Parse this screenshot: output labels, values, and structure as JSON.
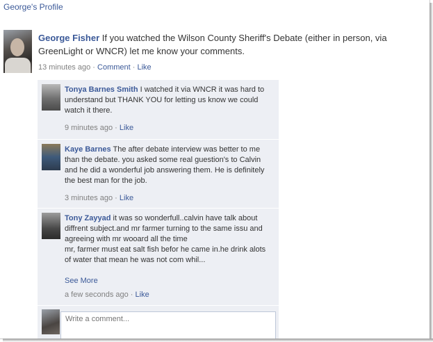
{
  "profile_link": "George's Profile",
  "post": {
    "author": "George Fisher",
    "text": "If you watched the Wilson County Sheriff's Debate (either in person, via GreenLight or WNCR) let me know your comments.",
    "time": "13 minutes ago",
    "comment_label": "Comment",
    "like_label": "Like",
    "separator": "·"
  },
  "comments": [
    {
      "author": "Tonya Barnes Smith",
      "text": "I watched it via WNCR it was hard to understand but THANK YOU for letting us know we could watch it there.",
      "time": "9 minutes ago",
      "like_label": "Like"
    },
    {
      "author": "Kaye Barnes",
      "text": "The after debate interview was better to me than the debate.  you asked some real guestion's to Calvin and he did a wonderful job answering them. He is definitely the best man for the job.",
      "time": "3 minutes ago",
      "like_label": "Like"
    },
    {
      "author": "Tony Zayyad",
      "text": "it was so wonderfull..calvin have talk about diffrent subject.and mr farmer turning to the same issu and agreeing with mr wooard all the time",
      "text2": "mr, farmer must eat salt fish befor he came in.he drink alots of water that mean he was not com whil...",
      "see_more": "See More",
      "time": "a few seconds ago",
      "like_label": "Like"
    }
  ],
  "write_comment": {
    "placeholder": "Write a comment..."
  },
  "colors": {
    "link": "#3b5998",
    "comment_bg": "#edeff4",
    "meta": "#808080"
  }
}
